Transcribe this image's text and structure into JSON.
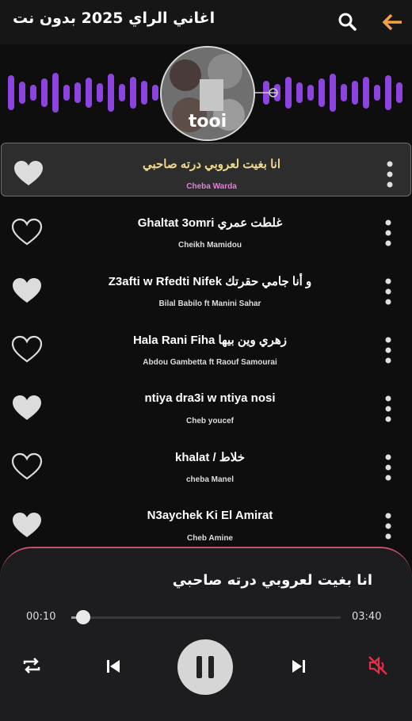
{
  "header": {
    "title": "اغاني الراي 2025 بدون نت",
    "search_icon": "search-icon",
    "back_icon": "back-arrow-icon",
    "accent": "#f2a14a"
  },
  "visualizer": {
    "color": "#8d43e0",
    "cover_text": "tooi"
  },
  "songs": [
    {
      "title": "انا بغيت لعروبي درته صاحبي",
      "artist": "Cheba Warda",
      "favorite": true,
      "selected": true
    },
    {
      "title": "Ghaltat 3omri غلطت عمري",
      "artist": "Cheikh Mamidou",
      "favorite": false,
      "selected": false
    },
    {
      "title": "Z3afti w Rfedti Nifek و أنا جامي حقرتك",
      "artist": "Bilal Babilo ft Manini Sahar",
      "favorite": true,
      "selected": false
    },
    {
      "title": "Hala Rani Fiha زهري وين بيها",
      "artist": "Abdou Gambetta ft Raouf Samourai",
      "favorite": false,
      "selected": false
    },
    {
      "title": "ntiya dra3i w ntiya nosi",
      "artist": "Cheb youcef",
      "favorite": true,
      "selected": false
    },
    {
      "title": "khalat / خلاط",
      "artist": "cheba Manel",
      "favorite": false,
      "selected": false
    },
    {
      "title": "N3aychek Ki El Amirat",
      "artist": "Cheb Amine",
      "favorite": true,
      "selected": false
    }
  ],
  "player": {
    "title": "انا بغيت لعروبي درته صاحبي",
    "current_time": "00:10",
    "total_time": "03:40",
    "progress": 0.045,
    "border_color": "#c2506f",
    "mute_color": "#e0314b"
  }
}
